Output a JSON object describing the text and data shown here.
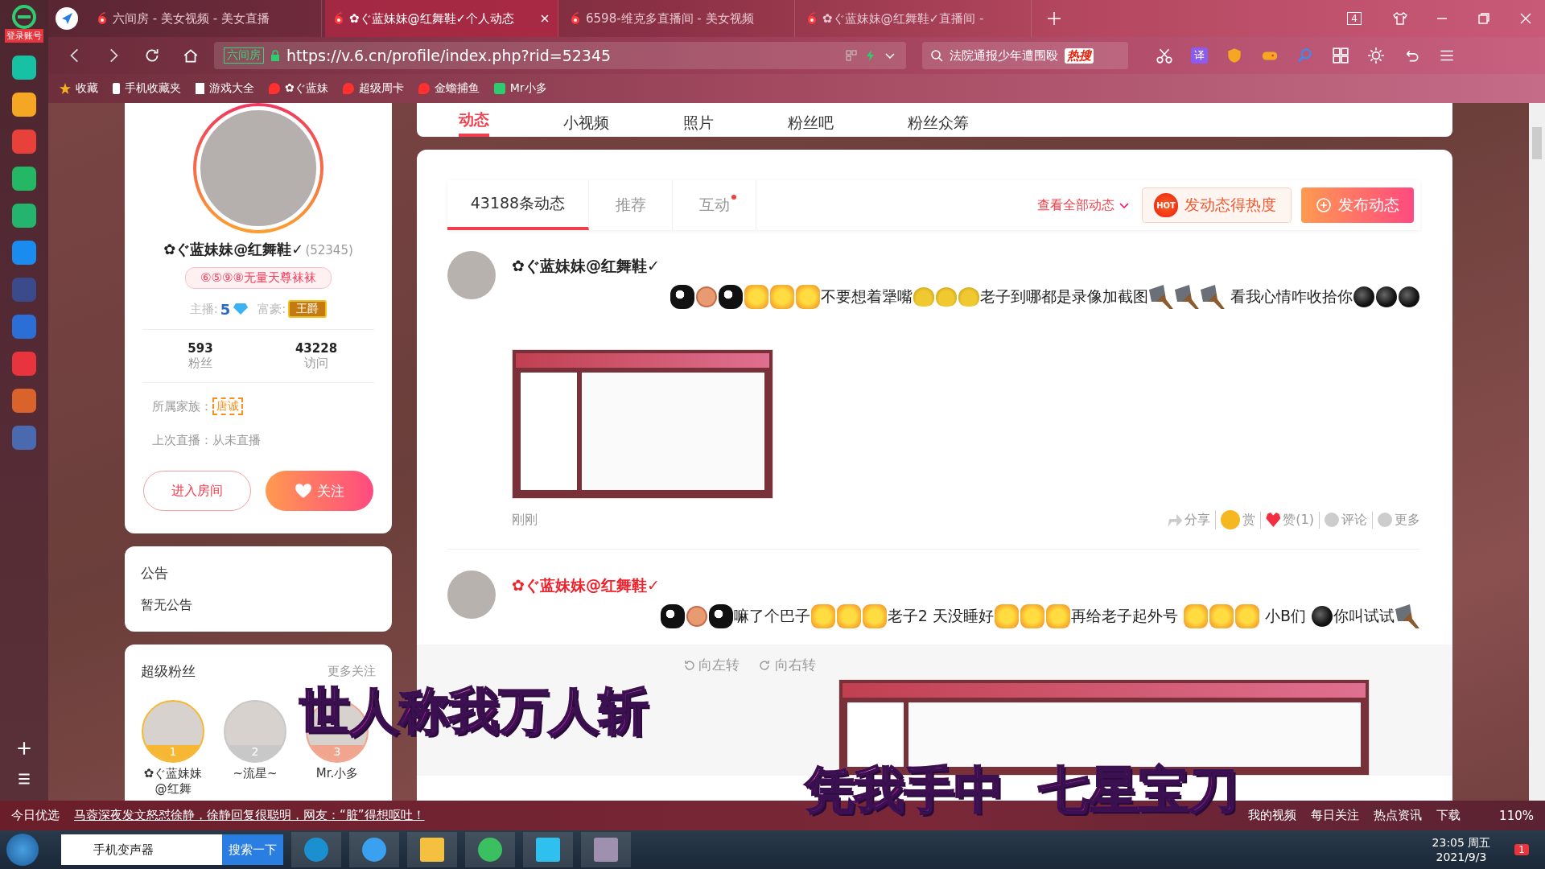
{
  "browser": {
    "login_label": "登录账号",
    "tabs": [
      {
        "title": "六间房 - 美女视频 - 美女直播",
        "selected": false
      },
      {
        "title": "✿ぐ蓝妹妹@红舞鞋✓个人动态",
        "selected": true
      },
      {
        "title": "6598-维克多直播间 - 美女视频",
        "selected": false
      },
      {
        "title": "✿ぐ蓝妹妹@红舞鞋✓直播间 -",
        "selected": false
      }
    ],
    "tab_count": "4",
    "address": {
      "site_label": "六间房",
      "url": "https://v.6.cn/profile/index.php?rid=52345"
    },
    "search": {
      "value": "法院通报少年遭围殴",
      "hot": "热搜"
    },
    "translate": "译",
    "bookmarks": [
      {
        "label": "收藏",
        "kind": "star"
      },
      {
        "label": "手机收藏夹",
        "kind": "phone"
      },
      {
        "label": "游戏大全",
        "kind": "page"
      },
      {
        "label": "✿ぐ蓝妹",
        "kind": "six"
      },
      {
        "label": "超级周卡",
        "kind": "six"
      },
      {
        "label": "金蟾捕鱼",
        "kind": "six"
      },
      {
        "label": "Mr小多",
        "kind": "green"
      }
    ]
  },
  "profile_nav": [
    {
      "label": "动态",
      "selected": true
    },
    {
      "label": "小视频",
      "selected": false
    },
    {
      "label": "照片",
      "selected": false
    },
    {
      "label": "粉丝吧",
      "selected": false
    },
    {
      "label": "粉丝众筹",
      "selected": false
    }
  ],
  "profile": {
    "name": "✿ぐ蓝妹妹@红舞鞋✓",
    "id": "(52345)",
    "signature": "⑥⑤⑨⑧无量天尊袜袜",
    "anchor_label": "主播:",
    "anchor_level": "5",
    "rich_label": "富豪:",
    "rich_badge": "王爵",
    "stats": [
      {
        "value": "593",
        "label": "粉丝"
      },
      {
        "value": "43228",
        "label": "访问"
      }
    ],
    "family_label": "所属家族：",
    "family": "唐诚",
    "last_live": "上次直播：从未直播",
    "enter_button": "进入房间",
    "follow_button": "关注"
  },
  "notice": {
    "title": "公告",
    "text": "暂无公告"
  },
  "super_fans": {
    "title": "超级粉丝",
    "more": "更多关注",
    "fans": [
      {
        "rank": "1",
        "name": "✿ぐ蓝妹妹@红舞",
        "color": "#f7b733"
      },
      {
        "rank": "2",
        "name": "~流星~",
        "color": "#c8c8c8"
      },
      {
        "rank": "3",
        "name": "Mr.小多",
        "color": "#f2a58e"
      }
    ]
  },
  "feed": {
    "tabs": [
      {
        "label": "43188条动态",
        "selected": true,
        "dot": false
      },
      {
        "label": "推荐",
        "selected": false,
        "dot": false
      },
      {
        "label": "互动",
        "selected": false,
        "dot": true
      }
    ],
    "view_all": "查看全部动态",
    "hot_badge": "HOT",
    "hot_button": "发动态得热度",
    "publish_button": "发布动态",
    "posts": [
      {
        "author": "✿ぐ蓝妹妹@红舞鞋✓",
        "highlight": false,
        "parts": [
          {
            "kind": "mask"
          },
          {
            "kind": "coin"
          },
          {
            "kind": "mask"
          },
          {
            "kind": "angry"
          },
          {
            "kind": "angry"
          },
          {
            "kind": "angry"
          },
          {
            "kind": "text",
            "text": "不要想着犟嘴"
          },
          {
            "kind": "gold"
          },
          {
            "kind": "gold"
          },
          {
            "kind": "gold"
          },
          {
            "kind": "text",
            "text": "老子到哪都是录像加截图"
          },
          {
            "kind": "knife"
          },
          {
            "kind": "knife"
          },
          {
            "kind": "knife"
          },
          {
            "kind": "text",
            "text": " 看我心情咋收拾你"
          },
          {
            "kind": "bomb"
          },
          {
            "kind": "bomb"
          },
          {
            "kind": "bomb"
          }
        ],
        "has_image": true,
        "time": "刚刚",
        "actions": [
          {
            "label": "分享",
            "kind": "share"
          },
          {
            "label": "赏",
            "kind": "reward"
          },
          {
            "label": "赞(1)",
            "kind": "like"
          },
          {
            "label": "评论",
            "kind": "comment"
          },
          {
            "label": "更多",
            "kind": "more"
          }
        ]
      },
      {
        "author": "✿ぐ蓝妹妹@红舞鞋✓",
        "highlight": true,
        "parts": [
          {
            "kind": "mask"
          },
          {
            "kind": "coin"
          },
          {
            "kind": "mask"
          },
          {
            "kind": "text",
            "text": "嘛了个巴子"
          },
          {
            "kind": "angry"
          },
          {
            "kind": "angry"
          },
          {
            "kind": "angry"
          },
          {
            "kind": "text",
            "text": "老子2 天没睡好"
          },
          {
            "kind": "angry"
          },
          {
            "kind": "angry"
          },
          {
            "kind": "angry"
          },
          {
            "kind": "text",
            "text": "再给老子起外号 "
          },
          {
            "kind": "angry"
          },
          {
            "kind": "angry"
          },
          {
            "kind": "angry"
          },
          {
            "kind": "text",
            "text": " 小B们 "
          },
          {
            "kind": "bomb"
          },
          {
            "kind": "text",
            "text": "你叫试试"
          },
          {
            "kind": "knife"
          }
        ],
        "image_tools": [
          {
            "label": "向左转",
            "kind": "left"
          },
          {
            "label": "向右转",
            "kind": "right"
          }
        ],
        "has_image": true
      }
    ]
  },
  "overlay_captions": [
    "世人称我万人斩",
    "凭我手中  七星宝刀"
  ],
  "status_bar": {
    "pick": "今日优选",
    "news": "马蓉深夜发文怒怼徐静，徐静回复很聪明，网友：“脏”得想呕吐！",
    "items": [
      "我的视频",
      "每日关注",
      "热点资讯"
    ],
    "download": "下载",
    "zoom": "110%"
  },
  "taskbar": {
    "search_value": "手机变声器",
    "search_button": "搜索一下",
    "time": "23:05 周五",
    "date": "2021/9/3",
    "notifications": "1"
  }
}
